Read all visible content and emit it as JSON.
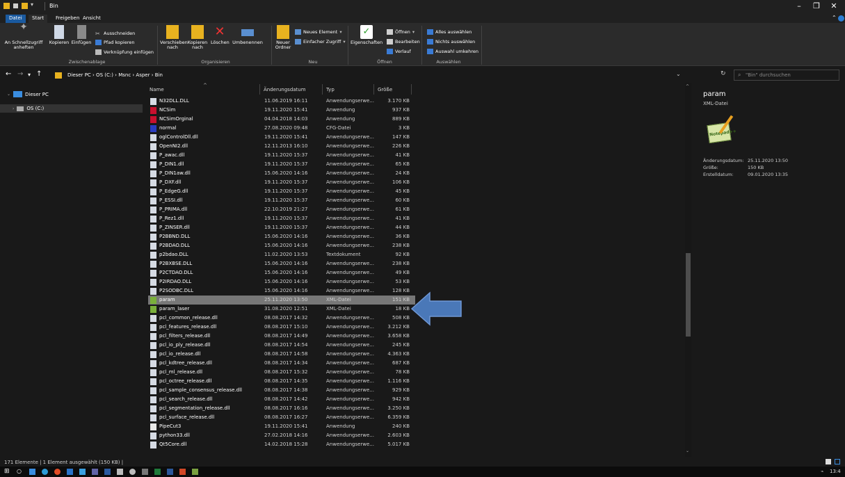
{
  "window": {
    "title": "Bin"
  },
  "ribbon_tabs": [
    "Datei",
    "Start",
    "Freigeben",
    "Ansicht"
  ],
  "ribbon": {
    "clipboard": {
      "pin_label": "An Schnellzugriff anheften",
      "copy_label": "Kopieren",
      "paste_label": "Einfügen",
      "cut_label": "Ausschneiden",
      "copy_path_label": "Pfad kopieren",
      "paste_shortcut_label": "Verknüpfung einfügen",
      "group": "Zwischenablage"
    },
    "organize": {
      "move_label": "Verschieben nach",
      "copyto_label": "Kopieren nach",
      "delete_label": "Löschen",
      "rename_label": "Umbenennen",
      "group": "Organisieren"
    },
    "new": {
      "new_folder_label": "Neuer Ordner",
      "new_item_label": "Neues Element",
      "easy_access_label": "Einfacher Zugriff",
      "group": "Neu"
    },
    "open": {
      "properties_label": "Eigenschaften",
      "open_label": "Öffnen",
      "edit_label": "Bearbeiten",
      "history_label": "Verlauf",
      "group": "Öffnen"
    },
    "select": {
      "select_all_label": "Alles auswählen",
      "select_none_label": "Nichts auswählen",
      "invert_label": "Auswahl umkehren",
      "group": "Auswählen"
    }
  },
  "address": {
    "crumbs": "Dieser PC  ›  OS (C:)  ›  Msnc  ›  Asper  ›  Bin",
    "search_placeholder": "\"Bin\" durchsuchen"
  },
  "nav": [
    {
      "label": "Dieser PC"
    },
    {
      "label": "OS (C:)"
    }
  ],
  "columns": {
    "name": "Name",
    "date": "Änderungsdatum",
    "type": "Typ",
    "size": "Größe"
  },
  "files": [
    {
      "name": "N32DLL.DLL",
      "date": "11.06.2019 16:11",
      "type": "Anwendungserwe...",
      "size": "3.170 KB",
      "icon": "dll"
    },
    {
      "name": "NCSim",
      "date": "19.11.2020 15:41",
      "type": "Anwendung",
      "size": "937 KB",
      "icon": "app"
    },
    {
      "name": "NCSimOrginal",
      "date": "04.04.2018 14:03",
      "type": "Anwendung",
      "size": "889 KB",
      "icon": "app"
    },
    {
      "name": "normal",
      "date": "27.08.2020 09:48",
      "type": "CFG-Datei",
      "size": "3 KB",
      "icon": "cfg"
    },
    {
      "name": "oglControlDll.dll",
      "date": "19.11.2020 15:41",
      "type": "Anwendungserwe...",
      "size": "147 KB",
      "icon": "dll"
    },
    {
      "name": "OpenNI2.dll",
      "date": "12.11.2013 16:10",
      "type": "Anwendungserwe...",
      "size": "226 KB",
      "icon": "dll"
    },
    {
      "name": "P_awac.dll",
      "date": "19.11.2020 15:37",
      "type": "Anwendungserwe...",
      "size": "41 KB",
      "icon": "dll"
    },
    {
      "name": "P_DIN1.dll",
      "date": "19.11.2020 15:37",
      "type": "Anwendungserwe...",
      "size": "65 KB",
      "icon": "dll"
    },
    {
      "name": "P_DIN1aw.dll",
      "date": "15.06.2020 14:16",
      "type": "Anwendungserwe...",
      "size": "24 KB",
      "icon": "dll"
    },
    {
      "name": "P_DXF.dll",
      "date": "19.11.2020 15:37",
      "type": "Anwendungserwe...",
      "size": "106 KB",
      "icon": "dll"
    },
    {
      "name": "P_EdgeG.dll",
      "date": "19.11.2020 15:37",
      "type": "Anwendungserwe...",
      "size": "45 KB",
      "icon": "dll"
    },
    {
      "name": "P_ESSI.dll",
      "date": "19.11.2020 15:37",
      "type": "Anwendungserwe...",
      "size": "60 KB",
      "icon": "dll"
    },
    {
      "name": "P_PRIMA.dll",
      "date": "22.10.2019 21:27",
      "type": "Anwendungserwe...",
      "size": "61 KB",
      "icon": "dll"
    },
    {
      "name": "P_Rez1.dll",
      "date": "19.11.2020 15:37",
      "type": "Anwendungserwe...",
      "size": "41 KB",
      "icon": "dll"
    },
    {
      "name": "P_ZINSER.dll",
      "date": "19.11.2020 15:37",
      "type": "Anwendungserwe...",
      "size": "44 KB",
      "icon": "dll"
    },
    {
      "name": "P2BBND.DLL",
      "date": "15.06.2020 14:16",
      "type": "Anwendungserwe...",
      "size": "36 KB",
      "icon": "dll"
    },
    {
      "name": "P2BDAO.DLL",
      "date": "15.06.2020 14:16",
      "type": "Anwendungserwe...",
      "size": "238 KB",
      "icon": "dll"
    },
    {
      "name": "p2bdao.DLL",
      "date": "11.02.2020 13:53",
      "type": "Textdokument",
      "size": "92 KB",
      "icon": "dll"
    },
    {
      "name": "P2BXBSE.DLL",
      "date": "15.06.2020 14:16",
      "type": "Anwendungserwe...",
      "size": "238 KB",
      "icon": "dll"
    },
    {
      "name": "P2CTDAO.DLL",
      "date": "15.06.2020 14:16",
      "type": "Anwendungserwe...",
      "size": "49 KB",
      "icon": "dll"
    },
    {
      "name": "P2IRDAO.DLL",
      "date": "15.06.2020 14:16",
      "type": "Anwendungserwe...",
      "size": "53 KB",
      "icon": "dll"
    },
    {
      "name": "P2SODBC.DLL",
      "date": "15.06.2020 14:16",
      "type": "Anwendungserwe...",
      "size": "128 KB",
      "icon": "dll"
    },
    {
      "name": "param",
      "date": "25.11.2020 13:50",
      "type": "XML-Datei",
      "size": "151 KB",
      "icon": "xml",
      "selected": true
    },
    {
      "name": "param_laser",
      "date": "31.08.2020 12:51",
      "type": "XML-Datei",
      "size": "18 KB",
      "icon": "xml"
    },
    {
      "name": "pcl_common_release.dll",
      "date": "08.08.2017 14:32",
      "type": "Anwendungserwe...",
      "size": "508 KB",
      "icon": "dll"
    },
    {
      "name": "pcl_features_release.dll",
      "date": "08.08.2017 15:10",
      "type": "Anwendungserwe...",
      "size": "3.212 KB",
      "icon": "dll"
    },
    {
      "name": "pcl_filters_release.dll",
      "date": "08.08.2017 14:49",
      "type": "Anwendungserwe...",
      "size": "3.658 KB",
      "icon": "dll"
    },
    {
      "name": "pcl_io_ply_release.dll",
      "date": "08.08.2017 14:54",
      "type": "Anwendungserwe...",
      "size": "245 KB",
      "icon": "dll"
    },
    {
      "name": "pcl_io_release.dll",
      "date": "08.08.2017 14:58",
      "type": "Anwendungserwe...",
      "size": "4.363 KB",
      "icon": "dll"
    },
    {
      "name": "pcl_kdtree_release.dll",
      "date": "08.08.2017 14:34",
      "type": "Anwendungserwe...",
      "size": "687 KB",
      "icon": "dll"
    },
    {
      "name": "pcl_ml_release.dll",
      "date": "08.08.2017 15:32",
      "type": "Anwendungserwe...",
      "size": "78 KB",
      "icon": "dll"
    },
    {
      "name": "pcl_octree_release.dll",
      "date": "08.08.2017 14:35",
      "type": "Anwendungserwe...",
      "size": "1.116 KB",
      "icon": "dll"
    },
    {
      "name": "pcl_sample_consensus_release.dll",
      "date": "08.08.2017 14:38",
      "type": "Anwendungserwe...",
      "size": "929 KB",
      "icon": "dll"
    },
    {
      "name": "pcl_search_release.dll",
      "date": "08.08.2017 14:42",
      "type": "Anwendungserwe...",
      "size": "942 KB",
      "icon": "dll"
    },
    {
      "name": "pcl_segmentation_release.dll",
      "date": "08.08.2017 16:16",
      "type": "Anwendungserwe...",
      "size": "3.250 KB",
      "icon": "dll"
    },
    {
      "name": "pcl_surface_release.dll",
      "date": "08.08.2017 16:27",
      "type": "Anwendungserwe...",
      "size": "6.359 KB",
      "icon": "dll"
    },
    {
      "name": "PipeCut3",
      "date": "19.11.2020 15:41",
      "type": "Anwendung",
      "size": "240 KB",
      "icon": "exe"
    },
    {
      "name": "python33.dll",
      "date": "27.02.2018 14:16",
      "type": "Anwendungserwe...",
      "size": "2.603 KB",
      "icon": "dll"
    },
    {
      "name": "Qt5Core.dll",
      "date": "14.02.2018 15:28",
      "type": "Anwendungserwe...",
      "size": "5.017 KB",
      "icon": "dll"
    }
  ],
  "preview": {
    "name": "param",
    "type": "XML-Datei",
    "modified_label": "Änderungsdatum:",
    "modified_value": "25.11.2020 13:50",
    "size_label": "Größe:",
    "size_value": "150 KB",
    "created_label": "Erstelldatum:",
    "created_value": "09.01.2020 13:35",
    "logo_text": "Notepad++"
  },
  "status": {
    "text": "171 Elemente  |  1 Element ausgewählt (150 KB)  |"
  },
  "taskbar": {
    "clock": "13:4"
  },
  "colors": {
    "accent": "#1a5aa0",
    "arrow": "#4a78b8",
    "selected_row": "#777777"
  }
}
